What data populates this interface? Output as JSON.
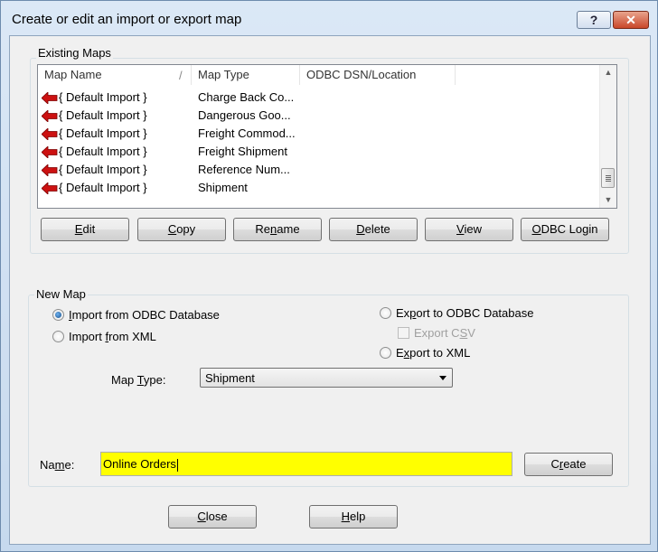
{
  "window": {
    "title": "Create or edit an import or export map",
    "help_caption": "?",
    "close_caption": "✕"
  },
  "existing_maps": {
    "group_label": "Existing Maps",
    "columns": [
      "Map Name",
      "Map Type",
      "ODBC DSN/Location"
    ],
    "header_separator": "/",
    "row_icon": "red-left-arrow-icon",
    "rows": [
      {
        "name": "{ Default Import }",
        "type": "Charge Back Co..."
      },
      {
        "name": "{ Default Import }",
        "type": "Dangerous Goo..."
      },
      {
        "name": "{ Default Import }",
        "type": "Freight Commod..."
      },
      {
        "name": "{ Default Import }",
        "type": "Freight Shipment"
      },
      {
        "name": "{ Default Import }",
        "type": "Reference Num..."
      },
      {
        "name": "{ Default Import }",
        "type": "Shipment"
      }
    ],
    "buttons": {
      "edit": {
        "pre": "",
        "key": "E",
        "post": "dit"
      },
      "copy": {
        "pre": "",
        "key": "C",
        "post": "opy"
      },
      "rename": {
        "pre": "Re",
        "key": "n",
        "post": "ame"
      },
      "delete": {
        "pre": "",
        "key": "D",
        "post": "elete"
      },
      "view": {
        "pre": "",
        "key": "V",
        "post": "iew"
      },
      "odbc_login": {
        "pre": "",
        "key": "O",
        "post": "DBC Login"
      }
    }
  },
  "new_map": {
    "group_label": "New Map",
    "import_odbc": {
      "pre": "",
      "key": "I",
      "post": "mport from ODBC Database",
      "selected": true
    },
    "import_xml": {
      "pre": "Import ",
      "key": "f",
      "post": "rom XML",
      "selected": false
    },
    "export_odbc": {
      "pre": "Ex",
      "key": "p",
      "post": "ort to ODBC Database",
      "selected": false
    },
    "export_csv": {
      "pre": "Export C",
      "key": "S",
      "post": "V",
      "checked": false,
      "enabled": false
    },
    "export_xml": {
      "pre": "E",
      "key": "x",
      "post": "port to XML",
      "selected": false
    },
    "map_type": {
      "pre": "Map ",
      "key": "T",
      "post": "ype:",
      "value": "Shipment"
    },
    "name": {
      "pre": "Na",
      "key": "m",
      "post": "e:",
      "value": "Online Orders",
      "highlight": "#ffff00"
    },
    "create": {
      "pre": "C",
      "key": "r",
      "post": "eate"
    }
  },
  "footer": {
    "close": {
      "pre": "",
      "key": "C",
      "post": "lose"
    },
    "help": {
      "pre": "",
      "key": "H",
      "post": "elp"
    }
  }
}
